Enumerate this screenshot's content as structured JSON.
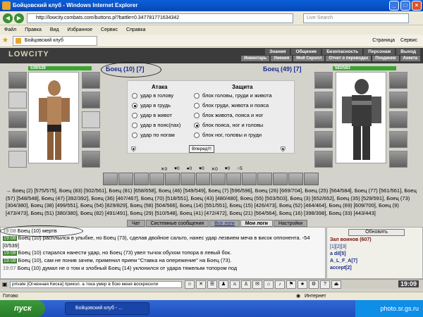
{
  "window": {
    "title": "Бойцовский клуб - Windows Internet Explorer",
    "controls": [
      "_",
      "□",
      "×"
    ]
  },
  "address": {
    "url": "http://lowcity.combats.com/buttons.pl?battle=0.347781771634342",
    "search_placeholder": "Live Search"
  },
  "menu": [
    "Файл",
    "Правка",
    "Вид",
    "Избранное",
    "Сервис",
    "Справка"
  ],
  "tab": {
    "label": "Бойцовский клуб"
  },
  "tools": [
    "Страница",
    "Сервис"
  ],
  "game": {
    "logo": "LOWCITY",
    "topnav": [
      "Знания",
      "Общение",
      "Безопасность",
      "Персонаж",
      "Выход"
    ],
    "subnav": [
      "Инвентарь",
      "Умения",
      "Мой Скролл",
      "Отчет о переводах",
      "Поединки",
      "Анкета"
    ],
    "left_hp": "539/539",
    "right_hp": "583/583",
    "left_fighter": "Боец (10) [7]",
    "right_fighter": "Боец (49) [7]",
    "attack_header": "Атака",
    "defense_header": "Защита",
    "attacks": [
      {
        "label": "удар в голову",
        "on": false
      },
      {
        "label": "удар в грудь",
        "on": true
      },
      {
        "label": "удар в живот",
        "on": false
      },
      {
        "label": "удар в пояс(пах)",
        "on": false
      },
      {
        "label": "удар по ногам",
        "on": false
      }
    ],
    "defenses": [
      {
        "label": "блок головы, груди и живота",
        "on": false
      },
      {
        "label": "блок груди, живота и пояса",
        "on": false
      },
      {
        "label": "блок живота, пояса и ног",
        "on": false
      },
      {
        "label": "блок пояса, ног и головы",
        "on": true
      },
      {
        "label": "блок ног, головы и груди",
        "on": false
      }
    ],
    "go_label": "Вперед!!!",
    "stats": [
      "0",
      "0",
      "0",
      "0",
      "0",
      "0",
      "5"
    ]
  },
  "players_list": "→ Боец (2) [575/575], Боец (83) [502/561], Боец (81) [658/658], Боец (46) [549/549], Боец (7) [596/596], Боец (26) [669/704], Боец (25) [564/584], Боец (77) [561/561], Боец (57) [548/548], Боец (47) [392/392], Боец (36) [467/467], Боец (70) [518/551], Боец (43) [480/480], Боец (55) [503/503], Боец (3) [652/652], Боец (35) [529/591], Боец (73) [304/380], Боец (38) [499/551], Боец (54) [829/829], Боец (58) [504/566], Боец (14) [551/551], Боец (15) [426/473], Боец (52) [464/464], Боец (69) [609/700], Боец (9) [473/473], Боец (51) [380/380], Боец (82) [491/491], Боец (29) [510/548], Боец (41) [472/472], Боец (21) [564/564], Боец (16) [398/398], Боец (33) [443/443]",
  "chat_tabs": [
    "Чат",
    "Системные сообщения",
    "Все логи",
    "Мои логи",
    "Настройки"
  ],
  "chat_log": [
    {
      "time": "19:08",
      "green": false,
      "text": "Боец (10) мертв"
    },
    {
      "time": "19:08",
      "green": true,
      "text": "Боец (10) расплылся в улыбке, но Боец (73), сделав двойное сальто, нанес удар лезвием меча в висок оппонента. -54 [0/539]"
    },
    {
      "time": "19:08",
      "green": true,
      "text": "Боец (10) старался нанести удар, но Боец (73) увел тычок обухом топора в левый бок."
    },
    {
      "time": "19:08",
      "green": true,
      "text": "Боец (10), сам не понив зачем, применил прием \"Ставка на опережение\" на Боец (73)."
    },
    {
      "time": "19:07",
      "green": false,
      "text": "Боец (10) думал не о том и злобный Боец (14) уклонился от удара тяжелым топором под"
    }
  ],
  "side": {
    "refresh": "Обновить",
    "hall": "Зал воинов (607)",
    "pages": "[1][2][3]",
    "users": [
      "a dil[5]",
      "A_L_F_A[7]",
      "accept[2]"
    ]
  },
  "chat_input": "private [Огненная Киска] прикол. а тока умер в бою меня воскресили",
  "clock": "19:09",
  "status_left": "Готово",
  "status_right": "Интернет",
  "taskbar": {
    "start": "пуск",
    "item": "Бойцовский клуб - ...",
    "tray": "photo.sr.gs.ru"
  }
}
